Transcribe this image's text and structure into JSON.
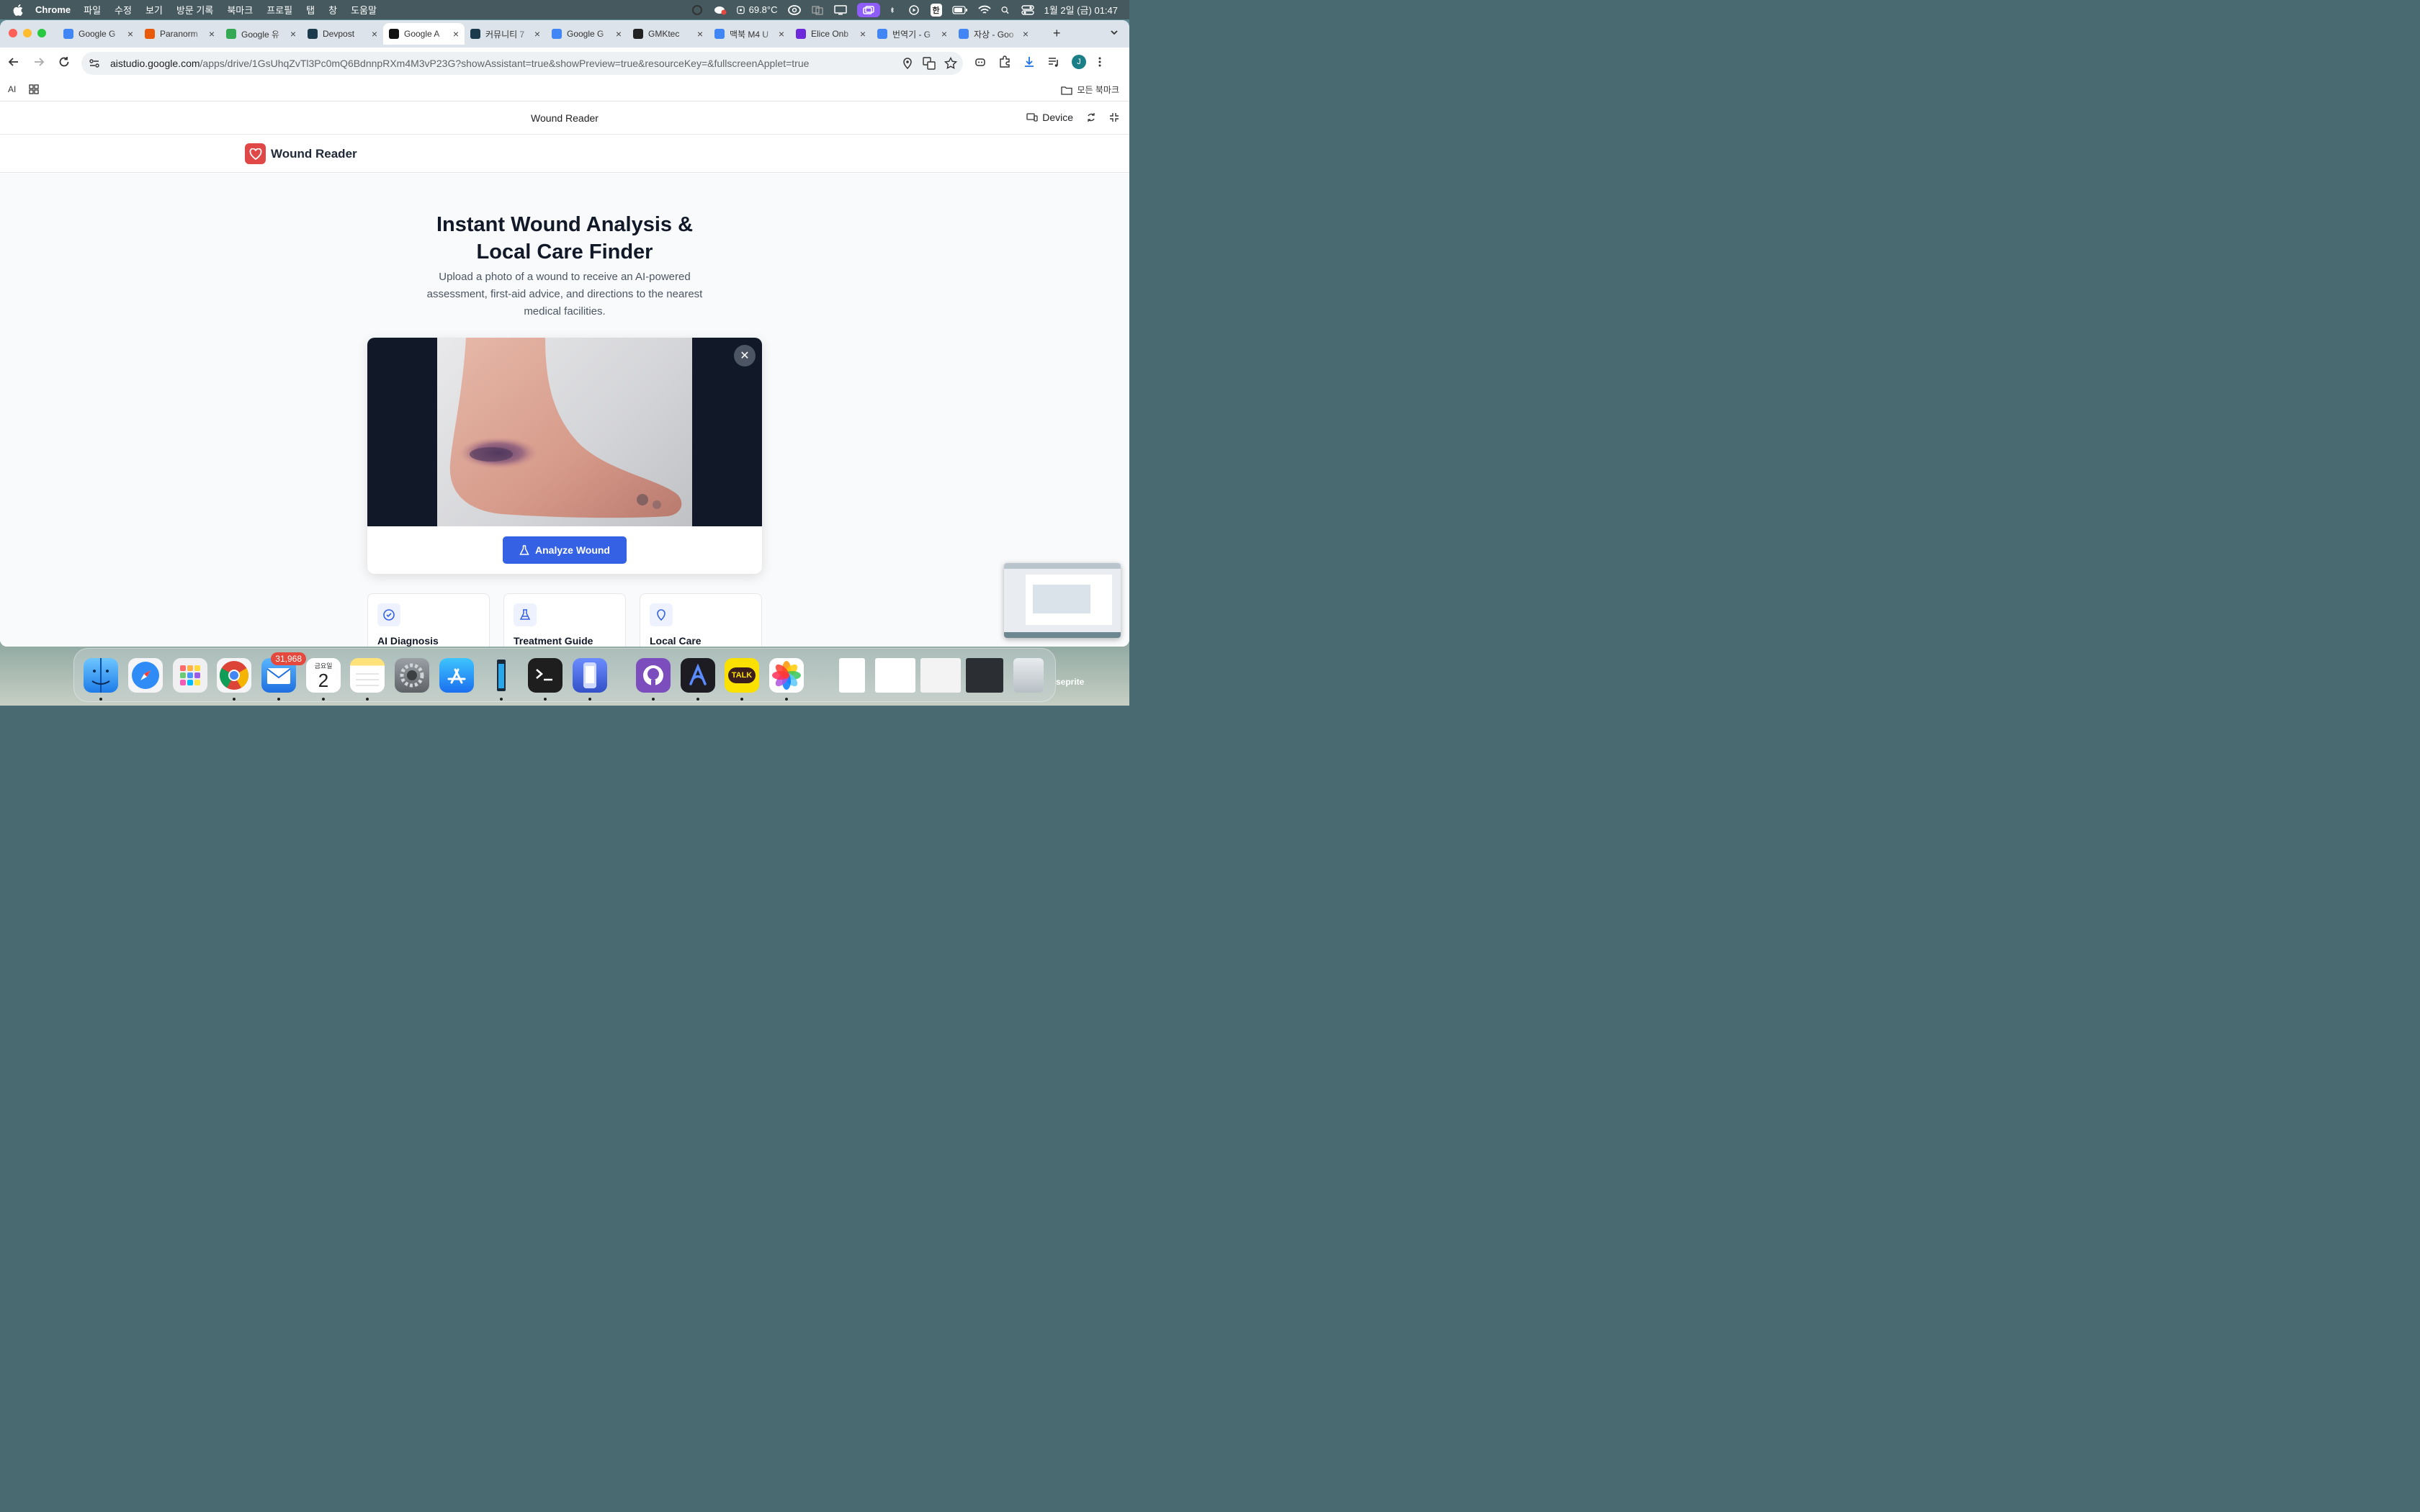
{
  "menubar": {
    "app": "Chrome",
    "items": [
      "파일",
      "수정",
      "보기",
      "방문 기록",
      "북마크",
      "프로필",
      "탭",
      "창",
      "도움말"
    ],
    "temperature": "69.8°C",
    "input_method": "한",
    "datetime": "1월 2일 (금) 01:47"
  },
  "tabs": [
    {
      "title": "Google G",
      "color": "#4285f4"
    },
    {
      "title": "Paranorm",
      "color": "#e8590c"
    },
    {
      "title": "Google 유",
      "color": "#34a853"
    },
    {
      "title": "Devpost",
      "color": "#1b3a4b"
    },
    {
      "title": "Google A",
      "color": "#111111",
      "active": true
    },
    {
      "title": "커뮤니티 7",
      "color": "#1b3a4b"
    },
    {
      "title": "Google G",
      "color": "#4285f4"
    },
    {
      "title": "GMKtec",
      "color": "#222222"
    },
    {
      "title": "맥북 M4 U",
      "color": "#4285f4"
    },
    {
      "title": "Elice Onb",
      "color": "#6d28d9"
    },
    {
      "title": "번역기 - G",
      "color": "#4285f4"
    },
    {
      "title": "자상 - Goo",
      "color": "#4285f4"
    }
  ],
  "omnibox": {
    "domain": "aistudio.google.com",
    "path": "/apps/drive/1GsUhqZvTl3Pc0mQ6BdnnpRXm4M3vP23G?showAssistant=true&showPreview=true&resourceKey=&fullscreenApplet=true"
  },
  "bookmarks": {
    "ai_label": "AI",
    "all_bookmarks": "모든 북마크"
  },
  "studio": {
    "title": "Wound Reader",
    "device_label": "Device"
  },
  "app": {
    "name": "Wound Reader",
    "hero_title_line1": "Instant Wound Analysis &",
    "hero_title_line2": "Local Care Finder",
    "hero_subtitle": "Upload a photo of a wound to receive an AI-powered assessment, first-aid advice, and directions to the nearest medical facilities.",
    "analyze_button": "Analyze Wound",
    "close_symbol": "✕",
    "features": [
      {
        "title": "AI Diagnosis",
        "icon": "check-circle-icon"
      },
      {
        "title": "Treatment Guide",
        "icon": "flask-icon"
      },
      {
        "title": "Local Care",
        "icon": "location-pin-icon"
      }
    ]
  },
  "dock": {
    "mail_badge": "31,968",
    "calendar_weekday": "금요일",
    "calendar_day": "2",
    "talk_label": "TALK",
    "user_label": "seprite"
  },
  "colors": {
    "accent_blue": "#3561e4",
    "logo_red": "#e04848",
    "page_bg": "#f8fafc"
  }
}
